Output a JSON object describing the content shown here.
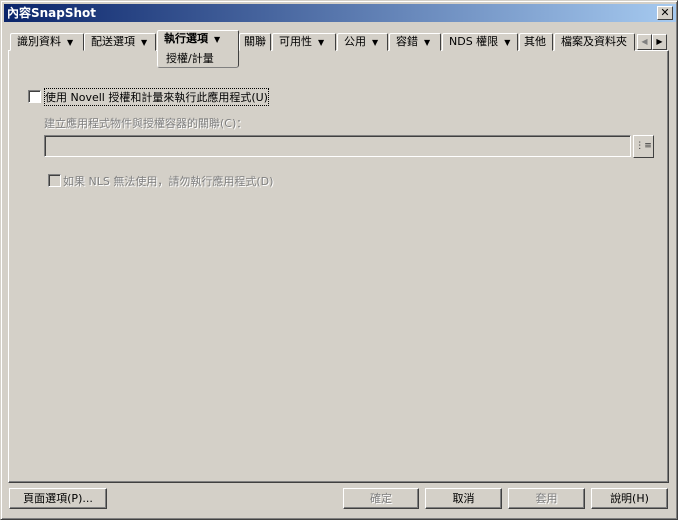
{
  "window": {
    "title": "內容SnapShot",
    "close": "✕"
  },
  "tabs": [
    {
      "label": "識別資料",
      "dropdown": true
    },
    {
      "label": "配送選項",
      "dropdown": true
    },
    {
      "label": "執行選項",
      "dropdown": true,
      "selected": true,
      "subpage": "授權/計量"
    },
    {
      "label": "關聯"
    },
    {
      "label": "可用性",
      "dropdown": true
    },
    {
      "label": "公用",
      "dropdown": true
    },
    {
      "label": "容錯",
      "dropdown": true
    },
    {
      "label": "NDS 權限",
      "dropdown": true
    },
    {
      "label": "其他"
    },
    {
      "label": "檔案及資料夾"
    }
  ],
  "tab_scroll": {
    "left": "◀",
    "right": "▶"
  },
  "content": {
    "use_nls_label": "使用 Novell 授權和計量來執行此應用程式(U)",
    "use_nls_checked": false,
    "assoc_label": "建立應用程式物件與授權容器的關聯(C)：",
    "assoc_value": "",
    "browse_icon": "tree-browse-icon",
    "dont_run_label": "如果 NLS 無法使用，請勿執行應用程式(D)",
    "dont_run_checked": false
  },
  "buttons": {
    "page_options": "頁面選項(P)...",
    "ok": "確定",
    "cancel": "取消",
    "apply": "套用",
    "help": "說明(H)"
  }
}
